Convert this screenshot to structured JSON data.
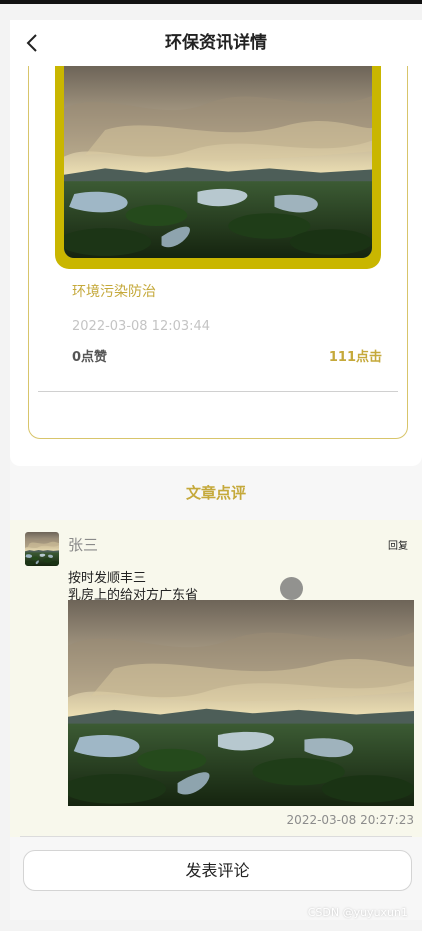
{
  "header": {
    "title": "环保资讯详情",
    "back_icon": "chevron-left-icon"
  },
  "news": {
    "category": "环境污染防治",
    "time": "2022-03-08 12:03:44",
    "likes": "0点赞",
    "clicks": "111点击"
  },
  "comments": {
    "heading": "文章点评",
    "items": [
      {
        "user": "张三",
        "reply": "回复",
        "lines": [
          "按时发顺丰三",
          "乳房上的给对方广东省"
        ],
        "time": "2022-03-08 20:27:23"
      }
    ]
  },
  "footer": {
    "post_button": "发表评论"
  },
  "watermark": "CSDN @yuyuxun1",
  "colors": {
    "accent": "#c5a93b",
    "frame": "#c9b600",
    "panel": "#f8f8ec"
  }
}
